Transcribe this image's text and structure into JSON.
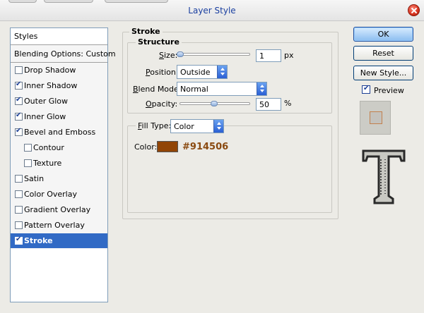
{
  "window": {
    "title": "Layer Style"
  },
  "styles_panel": {
    "header": "Styles",
    "blending_options": "Blending Options: Custom",
    "items": [
      {
        "label": "Drop Shadow",
        "checked": false,
        "sub": false,
        "selected": false
      },
      {
        "label": "Inner Shadow",
        "checked": true,
        "sub": false,
        "selected": false
      },
      {
        "label": "Outer Glow",
        "checked": true,
        "sub": false,
        "selected": false
      },
      {
        "label": "Inner Glow",
        "checked": true,
        "sub": false,
        "selected": false
      },
      {
        "label": "Bevel and Emboss",
        "checked": true,
        "sub": false,
        "selected": false
      },
      {
        "label": "Contour",
        "checked": false,
        "sub": true,
        "selected": false
      },
      {
        "label": "Texture",
        "checked": false,
        "sub": true,
        "selected": false
      },
      {
        "label": "Satin",
        "checked": false,
        "sub": false,
        "selected": false
      },
      {
        "label": "Color Overlay",
        "checked": false,
        "sub": false,
        "selected": false
      },
      {
        "label": "Gradient Overlay",
        "checked": false,
        "sub": false,
        "selected": false
      },
      {
        "label": "Pattern Overlay",
        "checked": false,
        "sub": false,
        "selected": false
      },
      {
        "label": "Stroke",
        "checked": true,
        "sub": false,
        "selected": true
      }
    ]
  },
  "stroke": {
    "title": "Stroke",
    "structure_title": "Structure",
    "size": {
      "label": "Size:",
      "value": "1",
      "unit": "px"
    },
    "position": {
      "label": "Position:",
      "value": "Outside"
    },
    "blend_mode": {
      "label": "Blend Mode:",
      "value": "Normal"
    },
    "opacity": {
      "label": "Opacity:",
      "value": "50",
      "unit": "%"
    },
    "fill_type": {
      "label": "Fill Type:",
      "value": "Color"
    },
    "color": {
      "label": "Color:",
      "hex_label": "#914506",
      "swatch": "#914506"
    }
  },
  "buttons": {
    "ok": "OK",
    "reset": "Reset",
    "new_style": "New Style...",
    "preview": "Preview"
  },
  "colors": {
    "selection": "#316ac5",
    "title_text": "#1a3fa0",
    "hex_text": "#8a4a10"
  }
}
